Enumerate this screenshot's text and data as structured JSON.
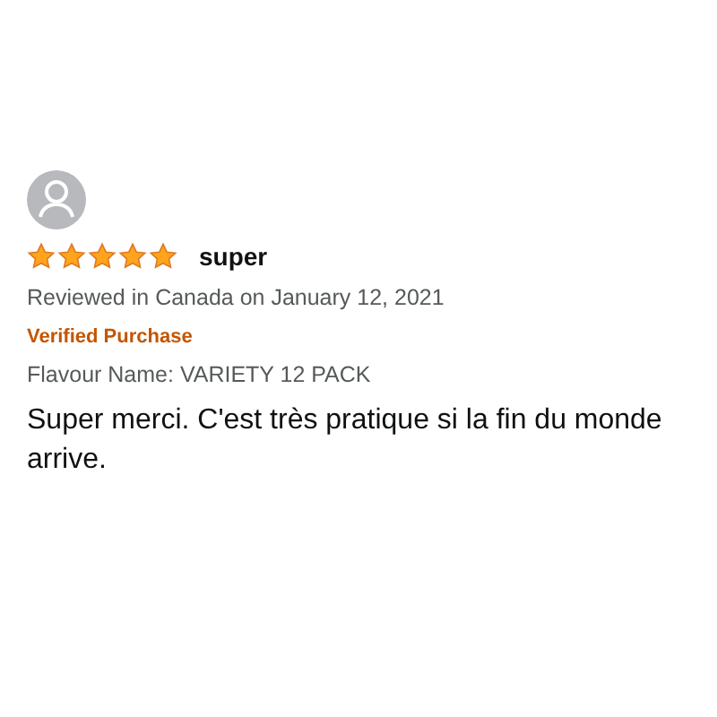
{
  "review": {
    "stars": 5,
    "title": "super",
    "meta": "Reviewed in Canada on January 12, 2021",
    "badge": "Verified Purchase",
    "variant": "Flavour Name: VARIETY 12 PACK",
    "body": "Super merci. C'est très pratique si la fin du monde arrive."
  }
}
